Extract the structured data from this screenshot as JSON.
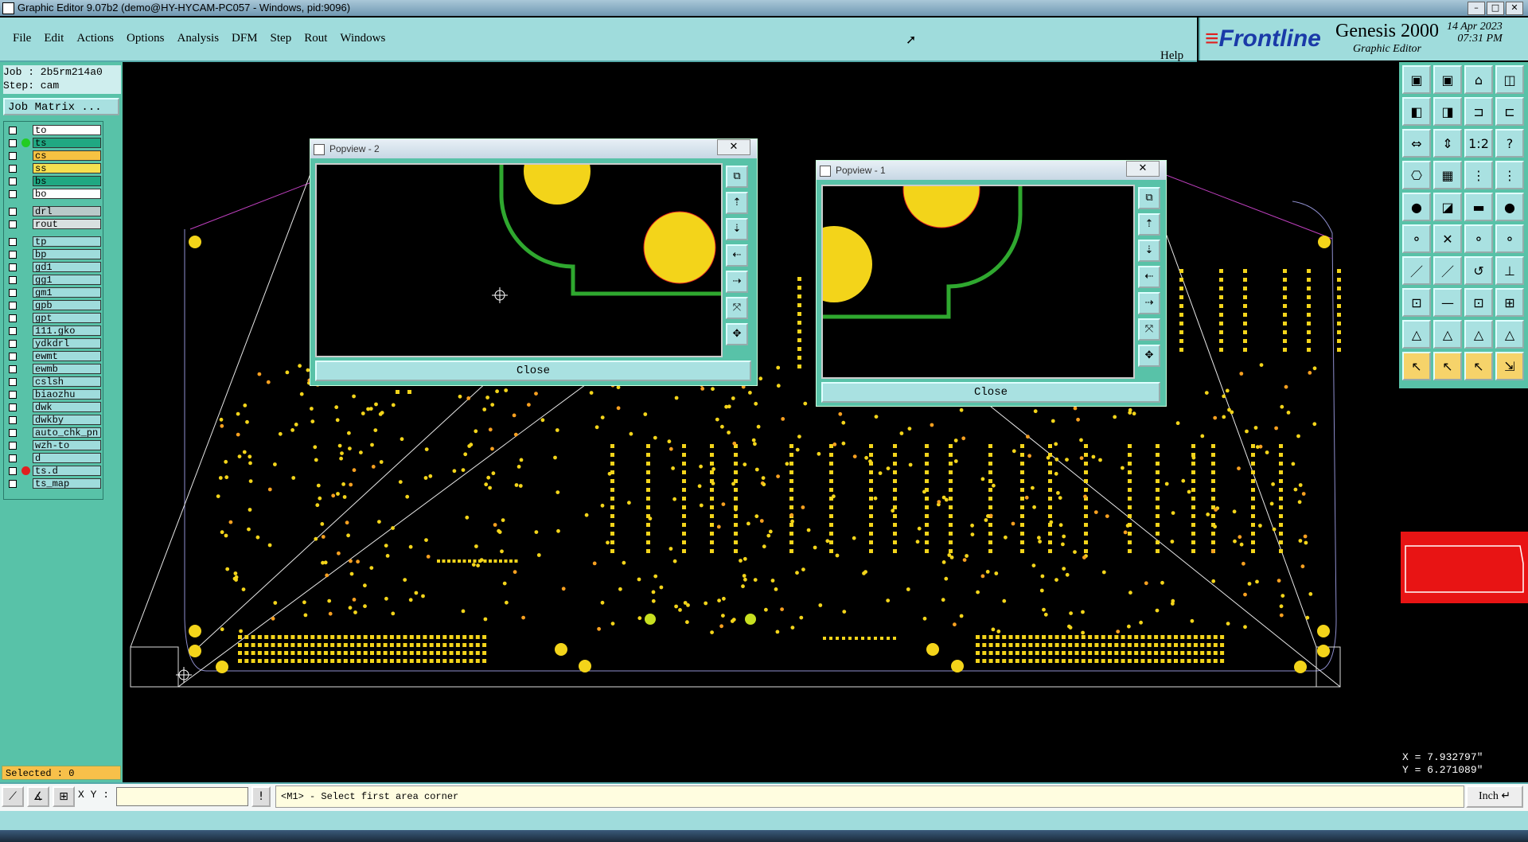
{
  "window": {
    "title": "Graphic Editor 9.07b2 (demo@HY-HYCAM-PC057 - Windows, pid:9096)",
    "min": "–",
    "max": "□",
    "close": "✕"
  },
  "menu": [
    "File",
    "Edit",
    "Actions",
    "Options",
    "Analysis",
    "DFM",
    "Step",
    "Rout",
    "Windows"
  ],
  "help_label": "Help",
  "logo": {
    "brand": "Frontline",
    "product": "Genesis 2000",
    "subtitle": "Graphic Editor",
    "date": "14 Apr 2023",
    "time": "07:31 PM"
  },
  "job": {
    "job_line": "Job : 2b5rm214a0",
    "step_line": "Step: cam",
    "matrix_button": "Job Matrix ..."
  },
  "layers": [
    {
      "name": "to",
      "color": "#ffffff",
      "dot": ""
    },
    {
      "name": "ts",
      "color": "#20a882",
      "dot": "#22cc22"
    },
    {
      "name": "cs",
      "color": "#f6c242",
      "dot": ""
    },
    {
      "name": "ss",
      "color": "#f6e050",
      "dot": ""
    },
    {
      "name": "bs",
      "color": "#20a882",
      "dot": ""
    },
    {
      "name": "bo",
      "color": "#ffffff",
      "dot": ""
    },
    {
      "name": "drl",
      "color": "#b9c9c9",
      "dot": ""
    },
    {
      "name": "rout",
      "color": "#d8e0e0",
      "dot": ""
    },
    {
      "name": "tp",
      "color": "#9fdcdc",
      "dot": ""
    },
    {
      "name": "bp",
      "color": "#9fdcdc",
      "dot": ""
    },
    {
      "name": "gd1",
      "color": "#9fdcdc",
      "dot": ""
    },
    {
      "name": "gg1",
      "color": "#9fdcdc",
      "dot": ""
    },
    {
      "name": "gm1",
      "color": "#9fdcdc",
      "dot": ""
    },
    {
      "name": "gpb",
      "color": "#9fdcdc",
      "dot": ""
    },
    {
      "name": "gpt",
      "color": "#9fdcdc",
      "dot": ""
    },
    {
      "name": "111.gko",
      "color": "#9fdcdc",
      "dot": ""
    },
    {
      "name": "ydkdrl",
      "color": "#9fdcdc",
      "dot": ""
    },
    {
      "name": "ewmt",
      "color": "#9fdcdc",
      "dot": ""
    },
    {
      "name": "ewmb",
      "color": "#9fdcdc",
      "dot": ""
    },
    {
      "name": "cslsh",
      "color": "#9fdcdc",
      "dot": ""
    },
    {
      "name": "biaozhu",
      "color": "#9fdcdc",
      "dot": ""
    },
    {
      "name": "dwk",
      "color": "#9fdcdc",
      "dot": ""
    },
    {
      "name": "dwkby",
      "color": "#9fdcdc",
      "dot": ""
    },
    {
      "name": "auto_chk_pn:",
      "color": "#9fdcdc",
      "dot": ""
    },
    {
      "name": "wzh-to",
      "color": "#9fdcdc",
      "dot": ""
    },
    {
      "name": "d",
      "color": "#9fdcdc",
      "dot": ""
    },
    {
      "name": "ts.d",
      "color": "#9fdcdc",
      "dot": "#e02020"
    },
    {
      "name": "ts_map",
      "color": "#9fdcdc",
      "dot": ""
    }
  ],
  "selected_text": "Selected : 0",
  "popview2": {
    "title": "Popview - 2",
    "close_label": "Close",
    "x_label": "✕"
  },
  "popview1": {
    "title": "Popview - 1",
    "close_label": "Close",
    "x_label": "✕"
  },
  "coords": {
    "x": "X = 7.932797\"",
    "y": "Y = 6.271089\""
  },
  "bottom": {
    "xy_label": "X Y :",
    "xy_value": "",
    "warn": "!",
    "message": "<M1> - Select first area corner",
    "units": "Inch ↵"
  },
  "tool_icons": [
    "▣",
    "▣",
    "⌂",
    "◫",
    "◧",
    "◨",
    "⊐",
    "⊏",
    "⇔",
    "⇕",
    "1:2",
    "?",
    "⎔",
    "▦",
    "⋮",
    "⋮",
    "●",
    "◪",
    "▬",
    "●",
    "⚬",
    "✕",
    "⚬",
    "⚬",
    "／",
    "／",
    "↺",
    "⊥",
    "⊡",
    "—",
    "⊡",
    "⊞",
    "△",
    "△",
    "△",
    "△",
    "↖",
    "↖",
    "↖",
    "⇲"
  ]
}
